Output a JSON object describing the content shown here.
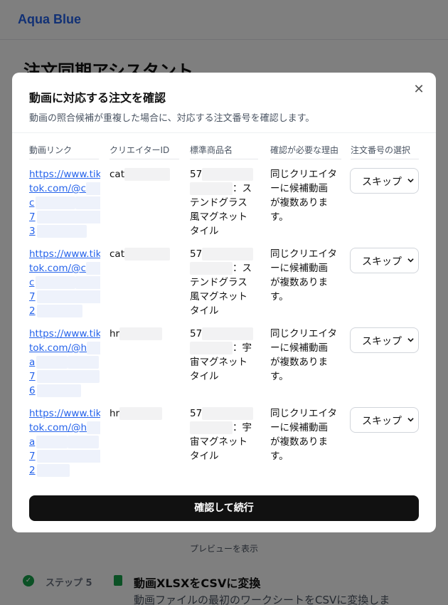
{
  "app": {
    "brand": "Aqua Blue",
    "page_title": "注文同期アシスタント"
  },
  "background": {
    "preview_label": "プレビューを表示",
    "step": {
      "number": "ステップ 5",
      "title": "動画XLSXをCSVに変換",
      "description": "動画ファイルの最初のワークシートをCSVに変換しま"
    }
  },
  "modal": {
    "title": "動画に対応する注文を確認",
    "description": "動画の照合候補が重複した場合に、対応する注文番号を確認します。",
    "columns": [
      "動画リンク",
      "クリエイターID",
      "標準商品名",
      "確認が必要な理由",
      "注文番号の選択"
    ],
    "rows": [
      {
        "link_lines": [
          "https://www.tik",
          "tok.com/@c",
          "c",
          "7",
          "3"
        ],
        "creator": "cat",
        "product_prefix": "57",
        "product_lines": [
          "：ス",
          "テンドグラス",
          "風マグネット",
          "タイル"
        ],
        "reason": [
          "同じクリエイタ",
          "ーに候補動画",
          "が複数ありま",
          "す。"
        ],
        "selection": "スキップ"
      },
      {
        "link_lines": [
          "https://www.tik",
          "tok.com/@c",
          "c",
          "7",
          "2"
        ],
        "creator": "cat",
        "product_prefix": "57",
        "product_lines": [
          "：ス",
          "テンドグラス",
          "風マグネット",
          "タイル"
        ],
        "reason": [
          "同じクリエイタ",
          "ーに候補動画",
          "が複数ありま",
          "す。"
        ],
        "selection": "スキップ"
      },
      {
        "link_lines": [
          "https://www.tik",
          "tok.com/@h",
          "a",
          "7",
          "6"
        ],
        "creator": "hr",
        "product_prefix": "57",
        "product_lines": [
          "：宇",
          "宙マグネット",
          "タイル"
        ],
        "reason": [
          "同じクリエイタ",
          "ーに候補動画",
          "が複数ありま",
          "す。"
        ],
        "selection": "スキップ"
      },
      {
        "link_lines": [
          "https://www.tik",
          "tok.com/@h",
          "a",
          "7",
          "2"
        ],
        "creator": "hr",
        "product_prefix": "57",
        "product_lines": [
          "：宇",
          "宙マグネット",
          "タイル"
        ],
        "reason": [
          "同じクリエイタ",
          "ーに候補動画",
          "が複数ありま",
          "す。"
        ],
        "selection": "スキップ"
      }
    ],
    "confirm_label": "確認して続行"
  },
  "colors": {
    "brand": "#2563eb",
    "link": "#2563eb",
    "primary_button": "#111111",
    "step_done": "#16a34a"
  },
  "icons": [
    "close-icon",
    "chevron-down-icon",
    "check-circle-icon",
    "file-icon"
  ]
}
